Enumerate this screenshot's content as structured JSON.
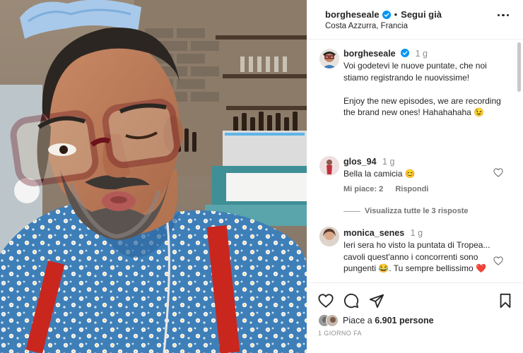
{
  "post": {
    "username": "borgheseale",
    "follow_label": "Segui già",
    "location": "Costa Azzurra, Francia",
    "caption": {
      "username": "borgheseale",
      "time": "1 g",
      "text": "Voi godetevi le nuove puntate, che noi stiamo registrando le nuovissime!\n\nEnjoy the new episodes, we are recording the brand new ones! Hahahahaha 😉"
    },
    "photo_alt": "Selfie di borgheseale"
  },
  "comments": [
    {
      "username": "glos_94",
      "time": "1 g",
      "text": "Bella la camicia 😊",
      "likes_label": "Mi piace: 2",
      "reply_label": "Rispondi",
      "view_replies_label": "Visualizza tutte le 3 risposte"
    },
    {
      "username": "monica_senes",
      "time": "1 g",
      "text": "Ieri sera ho visto la puntata di Tropea... cavoli quest'anno i concorrenti sono pungenti 😂. Tu sempre bellissimo ❤️"
    }
  ],
  "actions": {
    "like_icon": "heart-icon",
    "comment_icon": "comment-icon",
    "share_icon": "share-icon",
    "save_icon": "bookmark-icon",
    "likes_prefix": "Piace a",
    "likes_count": "6.901 persone",
    "date": "1 GIORNO FA"
  },
  "colors": {
    "text": "#262626",
    "muted": "#737373",
    "verified": "#0095f6",
    "heart_red": "#ed4956"
  }
}
